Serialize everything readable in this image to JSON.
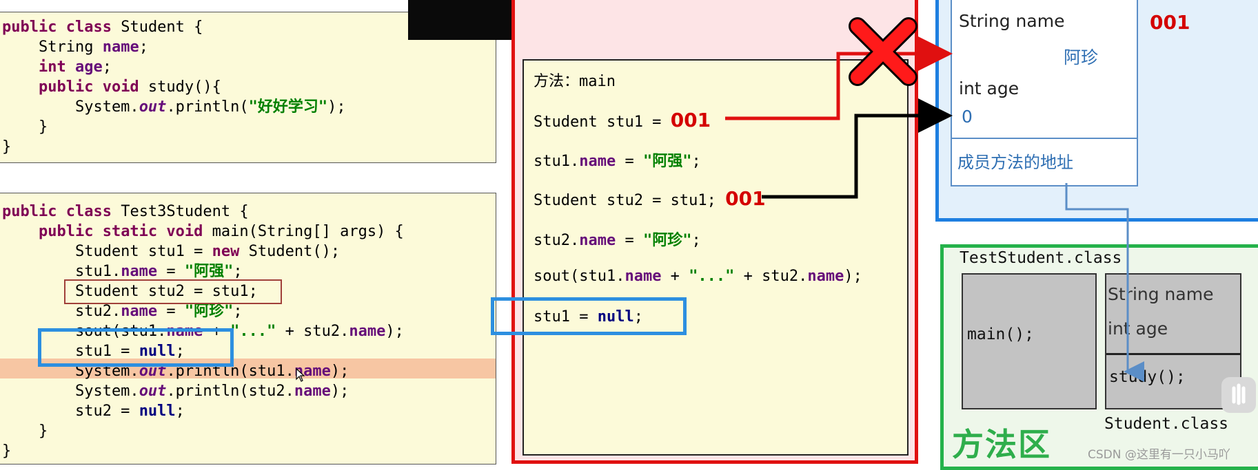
{
  "student_class_code": [
    "public class Student {",
    "    String name;",
    "    int age;",
    "    public void study(){",
    "        System.out.println(\"好好学习\");",
    "    }",
    "}"
  ],
  "test_class_code": [
    "public class Test3Student {",
    "    public static void main(String[] args) {",
    "        Student stu1 = new Student();",
    "        stu1.name = \"阿强\";",
    "        Student stu2 = stu1;",
    "        stu2.name = \"阿珍\";",
    "        sout(stu1.name + \"...\" + stu2.name);",
    "        stu1 = null;",
    "        System.out.println(stu1.name);",
    "        System.out.println(stu2.name);",
    "        stu2 = null;",
    "    }",
    "}"
  ],
  "stack_frame": {
    "method_label": "方法：main",
    "lines": [
      "Student stu1 = ",
      "stu1.name = \"阿强\";",
      "Student stu2 = stu1;",
      "stu2.name = \"阿珍\";",
      "sout(stu1.name + \"...\" + stu2.name);",
      "stu1 = null;"
    ],
    "stu1_ref": "001",
    "stu2_ref": "001"
  },
  "heap_object": {
    "address": "001",
    "field1_label": "String name",
    "field1_value": "阿珍",
    "field2_label": "int age",
    "field2_value": "0",
    "method_addr_label": "成员方法的地址"
  },
  "method_area": {
    "title": "方法区",
    "test_class_label": "TestStudent.class",
    "main_method": "main();",
    "student_fields": [
      "String name",
      "int age"
    ],
    "student_method": "study();",
    "student_class_label": "Student.class"
  },
  "watermark": "CSDN @这里有一只小马吖",
  "colors": {
    "heap_border": "#1e7fe0",
    "stack_border": "#e01010",
    "method_area_border": "#25b24b",
    "highlight_blue": "#2d8fe0"
  }
}
